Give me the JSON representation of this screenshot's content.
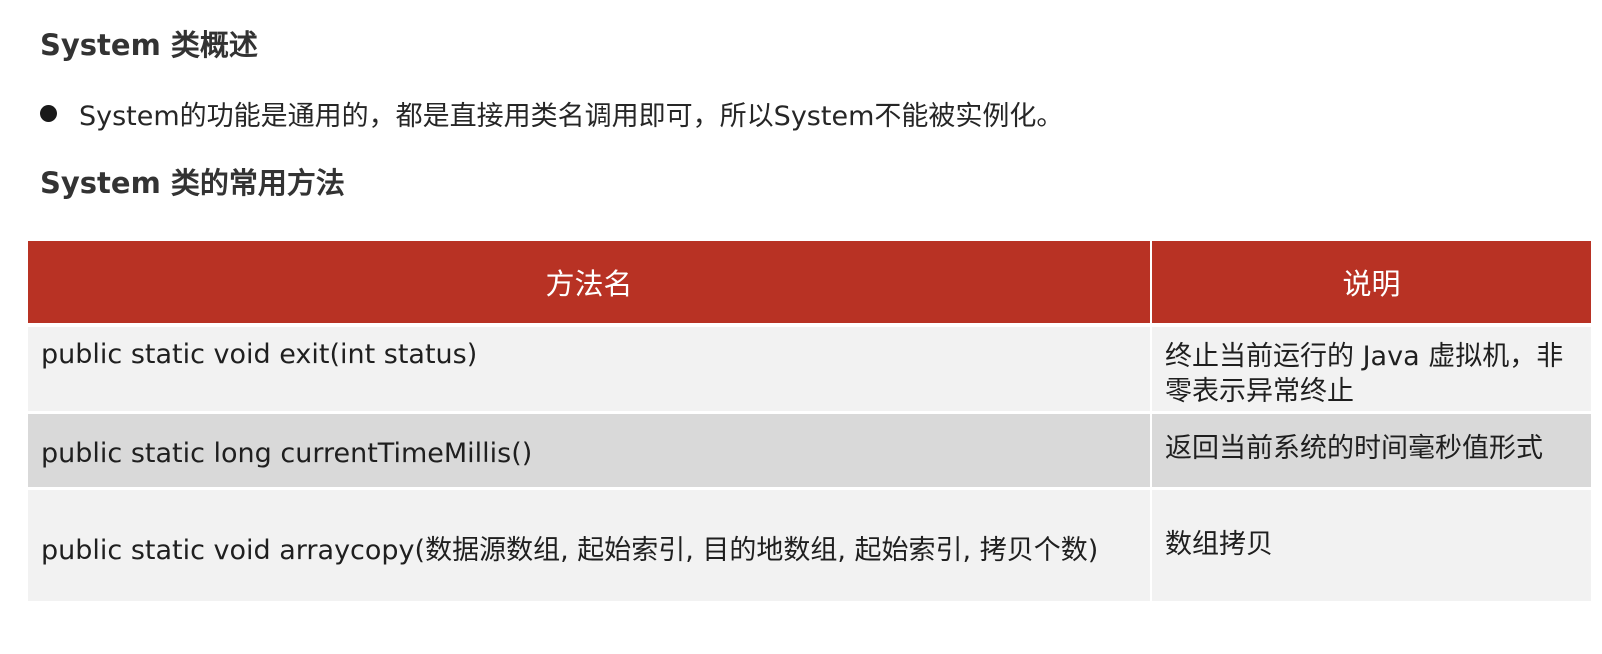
{
  "headings": {
    "overview": "System 类概述",
    "methods": "System 类的常用方法"
  },
  "bullets": [
    {
      "icon": "bullet-dot-icon",
      "text": "System的功能是通用的，都是直接用类名调用即可，所以System不能被实例化。"
    }
  ],
  "table": {
    "headers": {
      "method": "方法名",
      "description": "说明"
    },
    "rows": [
      {
        "method": "public static void exit(int status)",
        "description": "终止当前运行的 Java 虚拟机，非零表示异常终止"
      },
      {
        "method": "public static long currentTimeMillis()",
        "description": "返回当前系统的时间毫秒值形式"
      },
      {
        "method": "public static void arraycopy(数据源数组, 起始索引, 目的地数组, 起始索引, 拷贝个数)",
        "description": "数组拷贝"
      }
    ]
  },
  "colors": {
    "header_bg": "#b83224",
    "header_text": "#ffffff",
    "row_light": "#f2f2f2",
    "row_dark": "#d9d9d9"
  }
}
